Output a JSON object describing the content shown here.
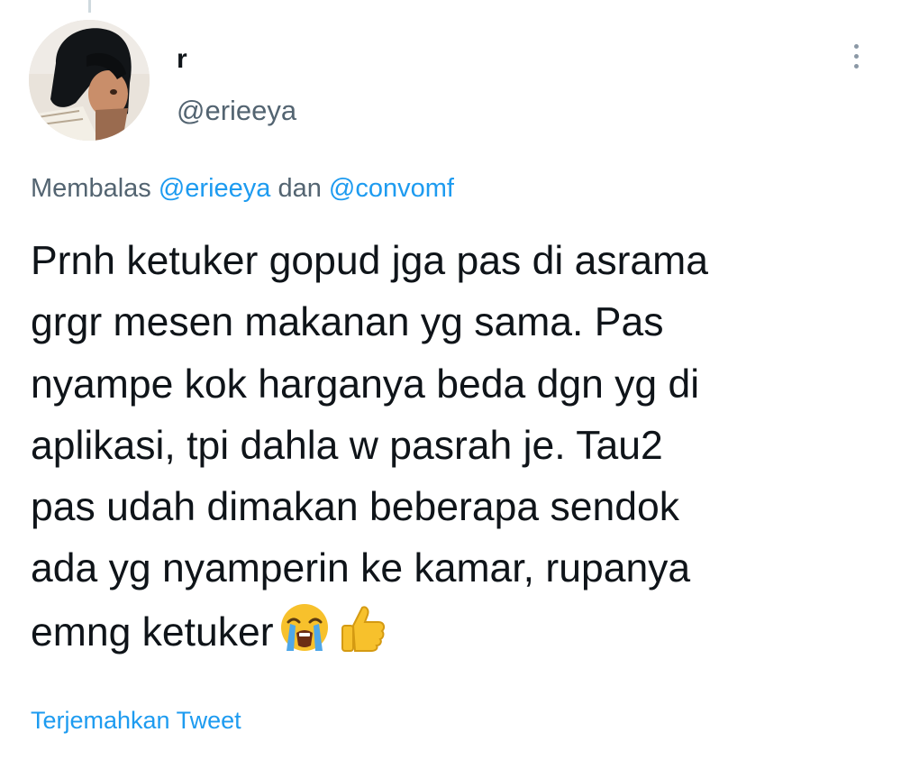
{
  "tweet": {
    "display_name": "r",
    "handle": "@erieeya",
    "more_icon": "more-vertical-icon",
    "reply_context": {
      "prefix": "Membalas",
      "mention_1": "@erieeya",
      "conjunction": "dan",
      "mention_2": "@convomf"
    },
    "text_lines": [
      "Prnh ketuker gopud jga pas di asrama",
      "grgr mesen makanan yg sama. Pas",
      "nyampe kok harganya beda dgn yg di",
      "aplikasi, tpi dahla w pasrah je. Tau2",
      "pas udah dimakan beberapa sendok",
      "ada yg nyamperin ke kamar, rupanya",
      "emng ketuker"
    ],
    "emojis": [
      "loudly-crying-face",
      "thumbs-up"
    ],
    "translate_label": "Terjemahkan Tweet"
  },
  "colors": {
    "text": "#0f1419",
    "secondary": "#536471",
    "accent": "#1d9bf0",
    "thread_line": "#cfd9de"
  }
}
